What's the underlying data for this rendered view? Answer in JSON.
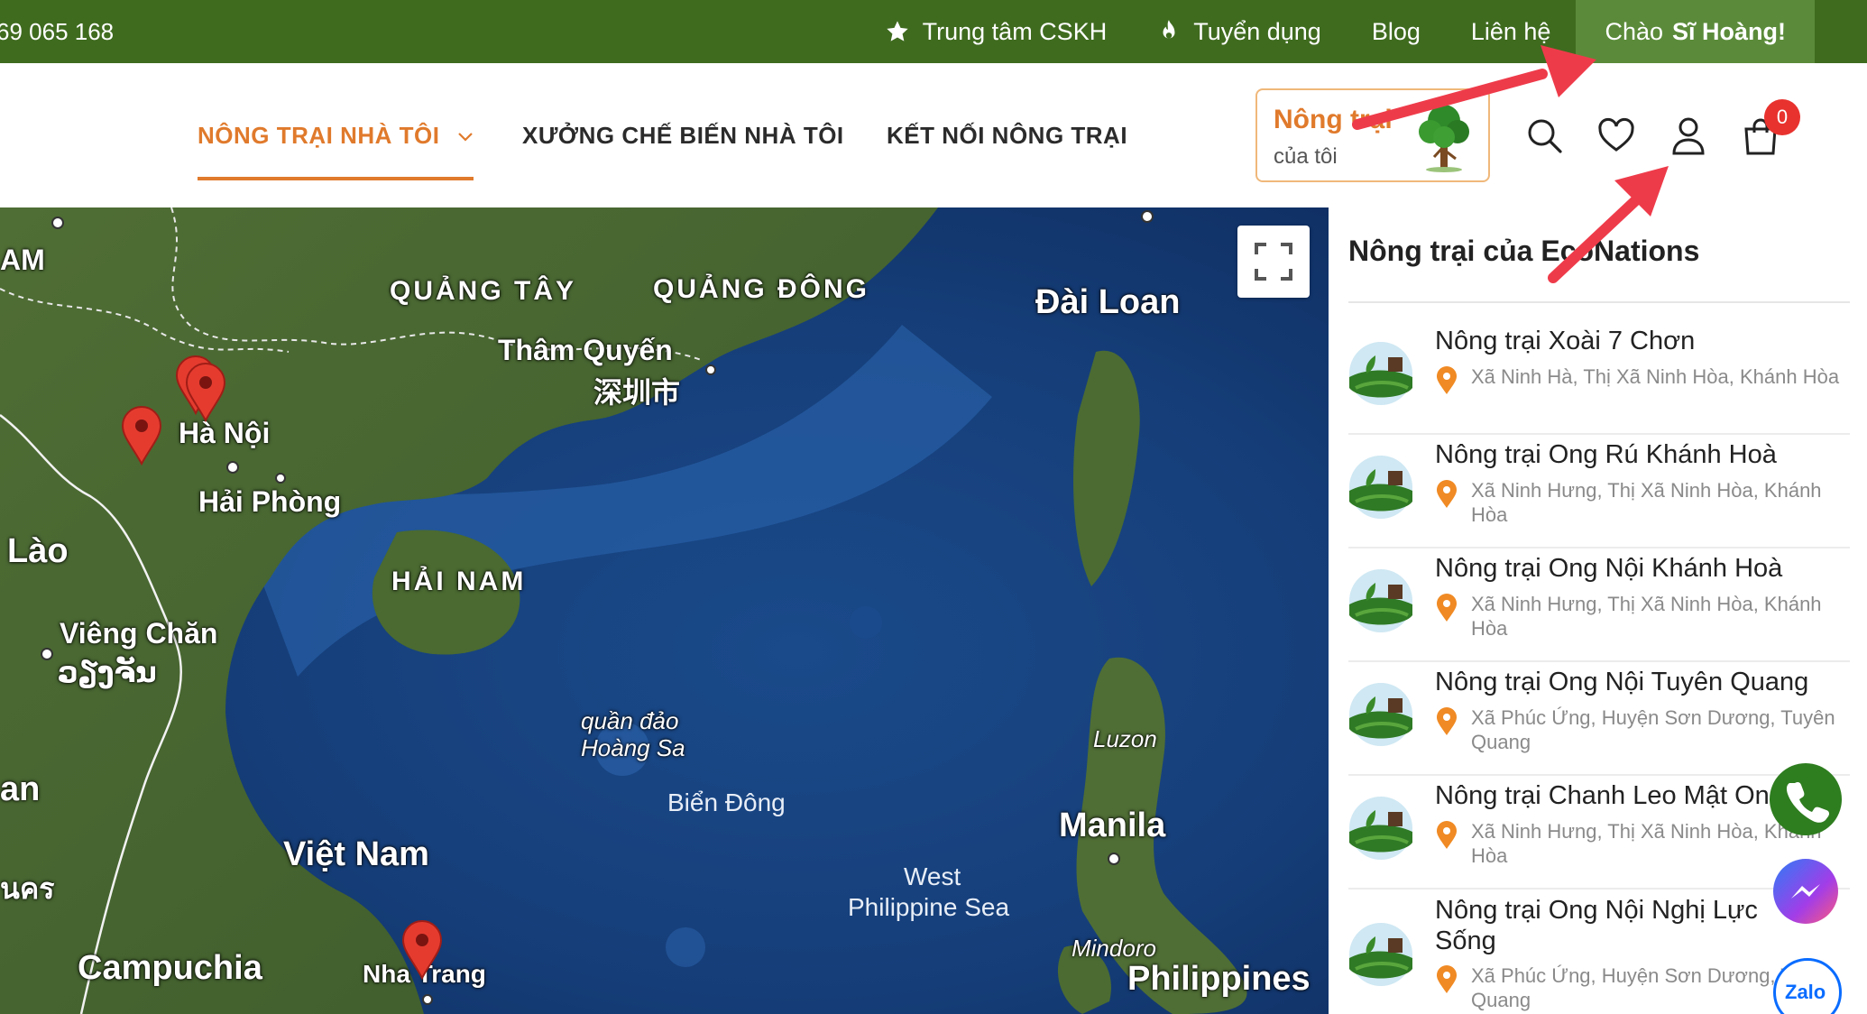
{
  "topbar": {
    "phone": "69 065 168",
    "links": {
      "support": "Trung tâm CSKH",
      "jobs": "Tuyển dụng",
      "blog": "Blog",
      "contact": "Liên hệ"
    },
    "greeting_prefix": "Chào",
    "user_name": "Sĩ Hoàng!"
  },
  "nav": {
    "items": [
      "NÔNG TRẠI NHÀ TÔI",
      "XƯỞNG CHẾ BIẾN NHÀ TÔI",
      "KẾT NỐI NÔNG TRẠI"
    ],
    "my_farm_line1": "Nông trại",
    "my_farm_line2": "của tôi",
    "cart_count": "0"
  },
  "map": {
    "labels": {
      "quang_tay": "QUẢNG TÂY",
      "quang_dong": "QUẢNG ĐÔNG",
      "dai_loan": "Đài Loan",
      "tham_quyen": "Thâm Quyến",
      "tham_quyen_cn": "深圳市",
      "ha_noi": "Hà Nội",
      "hai_phong": "Hải Phòng",
      "lao": "Lào",
      "hai_nam": "HẢI NAM",
      "vieng_chan": "Viêng Chăn",
      "vieng_chan_lo": "ວຽງຈັນ",
      "hoang_sa_1": "quần đảo",
      "hoang_sa_2": "Hoàng Sa",
      "luzon": "Luzon",
      "bien_dong": "Biển Đông",
      "manila": "Manila",
      "viet_nam": "Việt Nam",
      "west_ph_1": "West",
      "west_ph_2": "Philippine Sea",
      "mindoro": "Mindoro",
      "campuchia": "Campuchia",
      "nha_trang": "Nha Trang",
      "philippines": "Philippines",
      "edge_am": "AM",
      "edge_an": "an",
      "edge_kr": "นคร"
    }
  },
  "sidebar": {
    "title": "Nông trại của EcoNations",
    "farms": [
      {
        "name": "Nông trại Xoài 7 Chơn",
        "address": "Xã Ninh Hà, Thị Xã Ninh Hòa, Khánh Hòa"
      },
      {
        "name": "Nông trại Ong Rú Khánh Hoà",
        "address": "Xã Ninh Hưng, Thị Xã Ninh Hòa, Khánh Hòa"
      },
      {
        "name": "Nông trại Ong Nội Khánh Hoà",
        "address": "Xã Ninh Hưng, Thị Xã Ninh Hòa, Khánh Hòa"
      },
      {
        "name": "Nông trại Ong Nội Tuyên Quang",
        "address": "Xã Phúc Ứng, Huyện Sơn Dương, Tuyên Quang"
      },
      {
        "name": "Nông trại Chanh Leo Mật Ong",
        "address": "Xã Ninh Hưng, Thị Xã Ninh Hòa, Khánh Hòa"
      },
      {
        "name": "Nông trại Ong Nội Nghị Lực Sống",
        "address": "Xã Phúc Ứng, Huyện Sơn Dương, Tuyên Quang"
      }
    ]
  },
  "floating": {
    "zalo": "Zalo"
  },
  "colors": {
    "topbar_green": "#3f6b1f",
    "accent_orange": "#e07a2c",
    "badge_red": "#e8322e",
    "arrow_red": "#ee3b4a"
  }
}
